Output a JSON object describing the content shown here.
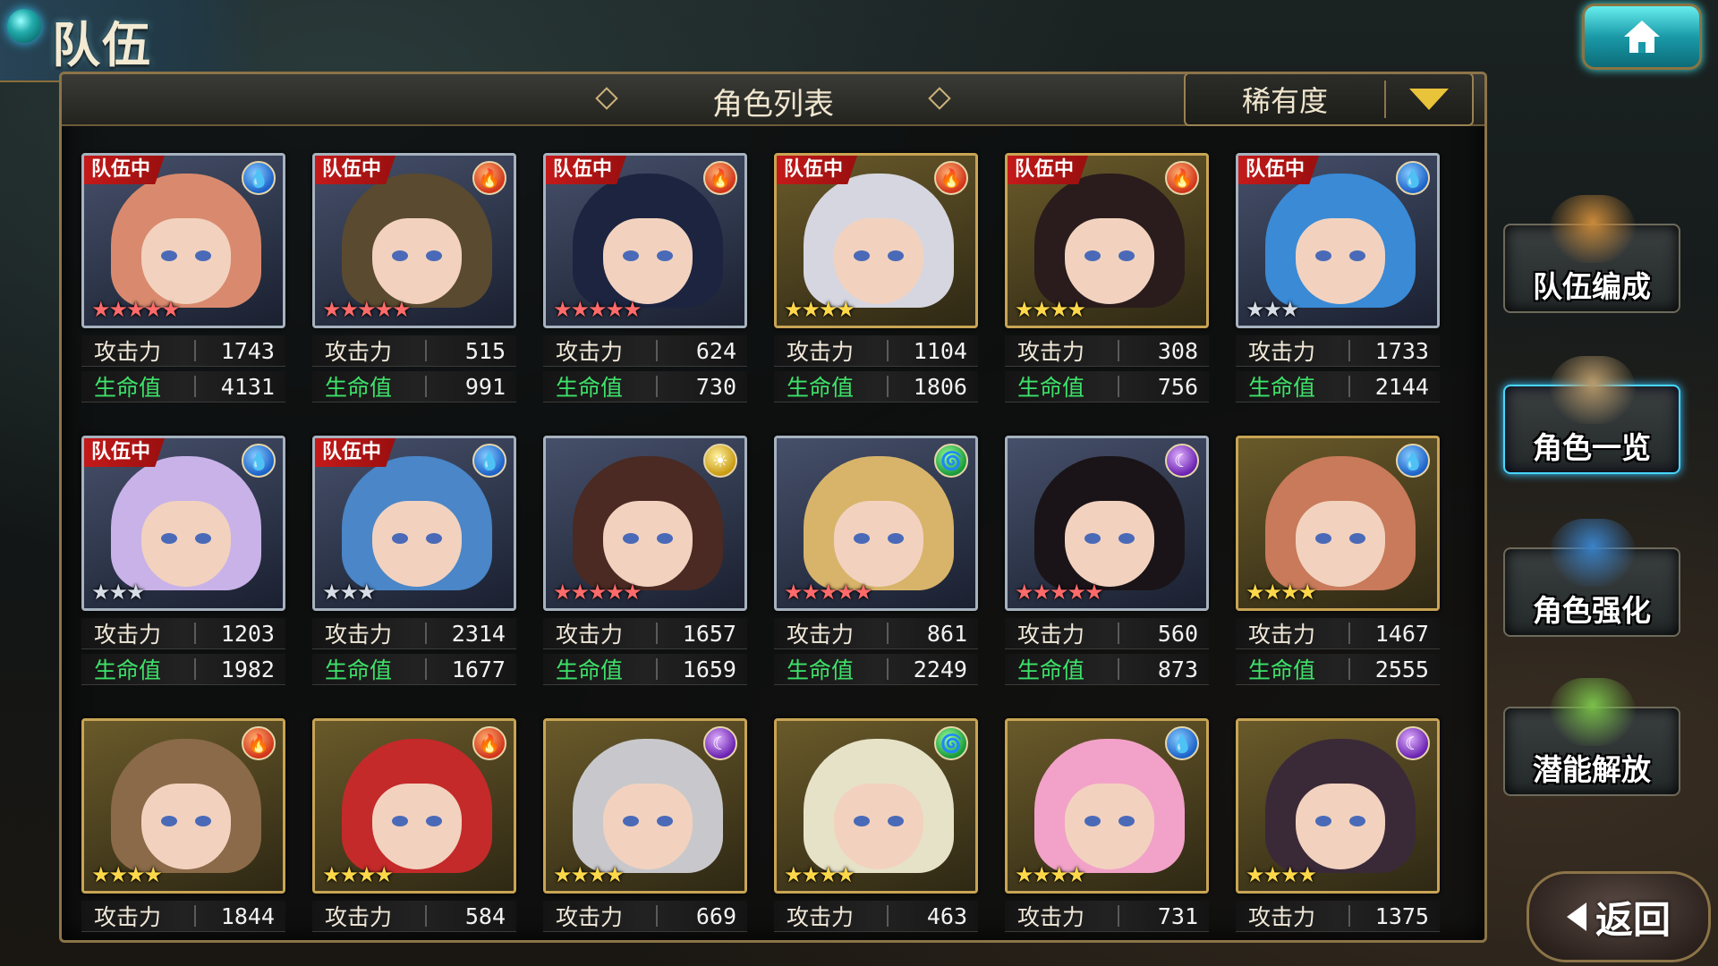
{
  "header": {
    "title": "队伍"
  },
  "panel": {
    "list_title": "角色列表",
    "sort_label": "稀有度"
  },
  "labels": {
    "atk": "攻击力",
    "hp": "生命值",
    "team_tag": "队伍中"
  },
  "menu": [
    {
      "label": "队伍编成",
      "icon": "party-members-icon"
    },
    {
      "label": "角色一览",
      "icon": "character-book-icon",
      "active": true
    },
    {
      "label": "角色强化",
      "icon": "enhance-card-icon"
    },
    {
      "label": "潜能解放",
      "icon": "potential-orb-icon"
    }
  ],
  "back_label": "返回",
  "colors": {
    "atk": "#f1e8d8",
    "hp": "#3ee26a",
    "team_tag": "#c41a1a",
    "active_border": "#48d6ff"
  },
  "characters": [
    {
      "in_team": true,
      "element": "water",
      "rarity": 5,
      "frame": "silver",
      "atk": "1743",
      "hp": "4131",
      "hair": "#d98a6e"
    },
    {
      "in_team": true,
      "element": "fire",
      "rarity": 5,
      "frame": "silver",
      "atk": "515",
      "hp": "991",
      "hair": "#5a4a30"
    },
    {
      "in_team": true,
      "element": "fire",
      "rarity": 5,
      "frame": "silver",
      "atk": "624",
      "hp": "730",
      "hair": "#1c2440"
    },
    {
      "in_team": true,
      "element": "fire",
      "rarity": 4,
      "frame": "gold",
      "atk": "1104",
      "hp": "1806",
      "hair": "#d6d6e0"
    },
    {
      "in_team": true,
      "element": "fire",
      "rarity": 4,
      "frame": "gold",
      "atk": "308",
      "hp": "756",
      "hair": "#2a1c1c"
    },
    {
      "in_team": true,
      "element": "water",
      "rarity": 3,
      "frame": "silver",
      "atk": "1733",
      "hp": "2144",
      "hair": "#3a8ad6"
    },
    {
      "in_team": true,
      "element": "water",
      "rarity": 3,
      "frame": "silver",
      "atk": "1203",
      "hp": "1982",
      "hair": "#c8b2e8"
    },
    {
      "in_team": true,
      "element": "water",
      "rarity": 3,
      "frame": "silver",
      "atk": "2314",
      "hp": "1677",
      "hair": "#4a86c8"
    },
    {
      "in_team": false,
      "element": "light",
      "rarity": 5,
      "frame": "silver",
      "atk": "1657",
      "hp": "1659",
      "hair": "#4a2a22"
    },
    {
      "in_team": false,
      "element": "wind",
      "rarity": 5,
      "frame": "silver",
      "atk": "861",
      "hp": "2249",
      "hair": "#d8b46a"
    },
    {
      "in_team": false,
      "element": "dark",
      "rarity": 5,
      "frame": "silver",
      "atk": "560",
      "hp": "873",
      "hair": "#1a1418"
    },
    {
      "in_team": false,
      "element": "water",
      "rarity": 4,
      "frame": "gold",
      "atk": "1467",
      "hp": "2555",
      "hair": "#c87a5a"
    },
    {
      "in_team": false,
      "element": "fire",
      "rarity": 4,
      "frame": "gold",
      "atk": "1844",
      "hp": "",
      "hair": "#8a6a48"
    },
    {
      "in_team": false,
      "element": "fire",
      "rarity": 4,
      "frame": "gold",
      "atk": "584",
      "hp": "",
      "hair": "#c42a2a"
    },
    {
      "in_team": false,
      "element": "dark",
      "rarity": 4,
      "frame": "gold",
      "atk": "669",
      "hp": "",
      "hair": "#c8c8cc"
    },
    {
      "in_team": false,
      "element": "wind",
      "rarity": 4,
      "frame": "gold",
      "atk": "463",
      "hp": "",
      "hair": "#e6e2c8"
    },
    {
      "in_team": false,
      "element": "water",
      "rarity": 4,
      "frame": "gold",
      "atk": "731",
      "hp": "",
      "hair": "#f2a2c8"
    },
    {
      "in_team": false,
      "element": "dark",
      "rarity": 4,
      "frame": "gold",
      "atk": "1375",
      "hp": "",
      "hair": "#3a2a38"
    }
  ]
}
